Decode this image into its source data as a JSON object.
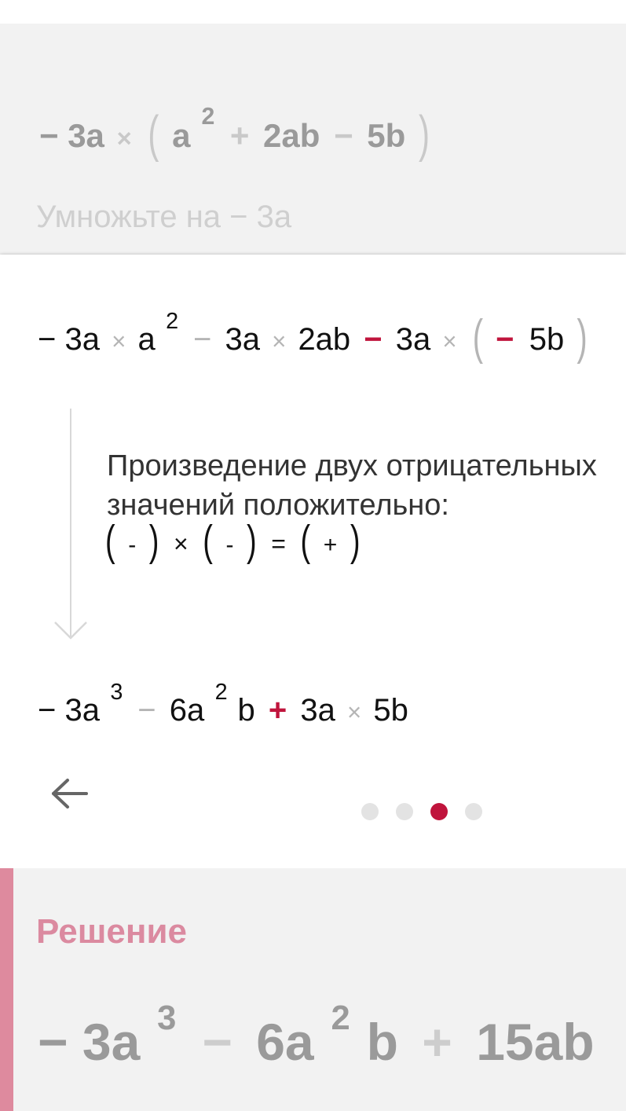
{
  "top": {
    "expression": [
      "−",
      "3a",
      "×",
      "(",
      "a",
      "2",
      "+",
      "2ab",
      "−",
      "5b",
      ")"
    ],
    "hint": "Умножьте на − 3a"
  },
  "step": {
    "expr1": [
      "−",
      "3a",
      "×",
      "a",
      "2",
      "−",
      "3a",
      "×",
      "2ab",
      "−",
      "3a",
      "×",
      "(",
      "−",
      "5b",
      ")"
    ],
    "explanation_line1": "Произведение двух отрицательных",
    "explanation_line2": "значений положительно:",
    "rule": [
      "(",
      "-",
      ")",
      "×",
      "(",
      "-",
      ")",
      "=",
      "(",
      "+",
      ")"
    ],
    "expr2": [
      "−",
      "3a",
      "3",
      "−",
      "6a",
      "2",
      "b",
      "+",
      "3a",
      "×",
      "5b"
    ],
    "pagination": {
      "count": 4,
      "active_index": 2
    }
  },
  "solution": {
    "title": "Решение",
    "expression": [
      "−",
      "3a",
      "3",
      "−",
      "6a",
      "2",
      "b",
      "+",
      "15ab"
    ]
  },
  "colors": {
    "accent_red": "#c0143c",
    "solution_pink": "#db8aa0",
    "solution_bar": "#de8a9e",
    "card_gray": "#f2f2f2",
    "dot_inactive": "#e3e3e3"
  },
  "icons": {
    "back": "arrow-left-icon",
    "flow": "arrow-down-icon"
  }
}
